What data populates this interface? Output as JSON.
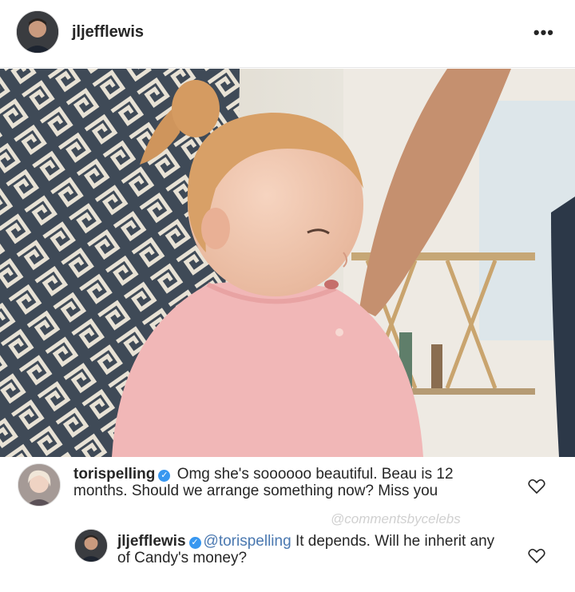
{
  "post": {
    "author": "jljefflewis",
    "more_icon": "more-horizontal-icon",
    "more_label": "•••"
  },
  "comments": [
    {
      "username": "torispelling",
      "verified": true,
      "text": "Omg she's soooooo beautiful. Beau is 12 months. Should we arrange something now? Miss you"
    },
    {
      "username": "jljefflewis",
      "verified": true,
      "mention": "@torispelling",
      "text": "It depends.  Will he inherit any of Candy's money?"
    }
  ],
  "watermark": "@commentsbycelebs",
  "icons": {
    "verified": "verified-badge-icon",
    "like": "heart-icon"
  },
  "colors": {
    "verified": "#3897f0",
    "mention": "#4a78b0",
    "sweater": "#f1b7b7"
  }
}
